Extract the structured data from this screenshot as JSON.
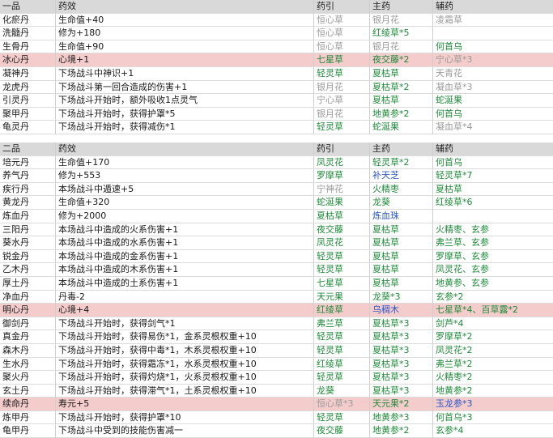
{
  "colors": {
    "header_bg": "#d9d9d9",
    "highlight_bg": "#f5cccc",
    "green": "#1f8a3a",
    "gray": "#9a9a9a",
    "blue": "#2a56c6"
  },
  "tables": [
    {
      "header": [
        "一品",
        "药效",
        "药引",
        "主药",
        "辅药"
      ],
      "rows": [
        {
          "name": "化瘀丹",
          "effect": "生命值+40",
          "yin": "恒心草",
          "yin_c": "gray",
          "main": "银月花",
          "main_c": "gray",
          "aux": "凌霜草",
          "aux_c": "gray",
          "hl": false
        },
        {
          "name": "洗髓丹",
          "effect": "修为+180",
          "yin": "恒心草",
          "yin_c": "gray",
          "main": "红绫草*5",
          "main_c": "green",
          "aux": "",
          "aux_c": "gray",
          "hl": false
        },
        {
          "name": "生骨丹",
          "effect": "生命值+90",
          "yin": "恒心草",
          "yin_c": "gray",
          "main": "银月花",
          "main_c": "gray",
          "aux": "何首乌",
          "aux_c": "green",
          "hl": false
        },
        {
          "name": "冰心丹",
          "effect": "心境+1",
          "yin": "七星草",
          "yin_c": "green",
          "main": "夜交藤*2",
          "main_c": "green",
          "aux": "宁心草*3",
          "aux_c": "gray",
          "hl": true
        },
        {
          "name": "凝神丹",
          "effect": "下场战斗中神识+1",
          "yin": "轻灵草",
          "yin_c": "green",
          "main": "夏枯草",
          "main_c": "green",
          "aux": "天青花",
          "aux_c": "gray",
          "hl": false
        },
        {
          "name": "龙虎丹",
          "effect": "下场战斗第一回合造成的伤害+1",
          "yin": "银月花",
          "yin_c": "gray",
          "main": "夏枯草*2",
          "main_c": "green",
          "aux": "凝血草*3",
          "aux_c": "gray",
          "hl": false
        },
        {
          "name": "引灵丹",
          "effect": "下场战斗开始时，额外吸收1点灵气",
          "yin": "宁心草",
          "yin_c": "gray",
          "main": "夏枯草",
          "main_c": "green",
          "aux": "蛇涎果",
          "aux_c": "green",
          "hl": false
        },
        {
          "name": "聚甲丹",
          "effect": "下场战斗开始时，获得护罩*5",
          "yin": "银月花",
          "yin_c": "gray",
          "main": "地黄参*2",
          "main_c": "green",
          "aux": "何首乌",
          "aux_c": "green",
          "hl": false
        },
        {
          "name": "龟灵丹",
          "effect": "下场战斗开始时，获得减伤*1",
          "yin": "轻灵草",
          "yin_c": "green",
          "main": "蛇涎果",
          "main_c": "green",
          "aux": "凝血草*4",
          "aux_c": "gray",
          "hl": false
        }
      ]
    },
    {
      "header": [
        "二品",
        "药效",
        "药引",
        "主药",
        "辅药"
      ],
      "rows": [
        {
          "name": "培元丹",
          "effect": "生命值+170",
          "yin": "凤灵花",
          "yin_c": "green",
          "main": "轻灵草*2",
          "main_c": "green",
          "aux": "何首乌",
          "aux_c": "green",
          "hl": false
        },
        {
          "name": "养气丹",
          "effect": "修为+553",
          "yin": "罗摩草",
          "yin_c": "green",
          "main": "补天芝",
          "main_c": "blue",
          "aux": "轻灵草*7",
          "aux_c": "green",
          "hl": false
        },
        {
          "name": "疾行丹",
          "effect": "本场战斗中遁速+5",
          "yin": "宁神花",
          "yin_c": "gray",
          "main": "火精枣",
          "main_c": "green",
          "aux": "夏枯草",
          "aux_c": "green",
          "hl": false
        },
        {
          "name": "黄龙丹",
          "effect": "生命值+320",
          "yin": "蛇涎果",
          "yin_c": "green",
          "main": "龙葵",
          "main_c": "green",
          "aux": "红绫草*6",
          "aux_c": "green",
          "hl": false
        },
        {
          "name": "炼血丹",
          "effect": "修为+2000",
          "yin": "夏枯草",
          "yin_c": "green",
          "main": "炼血珠",
          "main_c": "blue",
          "aux": "",
          "aux_c": "green",
          "hl": false
        },
        {
          "name": "三阳丹",
          "effect": "本场战斗中造成的火系伤害+1",
          "yin": "夜交藤",
          "yin_c": "green",
          "main": "夏枯草",
          "main_c": "green",
          "aux": "火精枣、玄参",
          "aux_c": "green",
          "hl": false
        },
        {
          "name": "葵水丹",
          "effect": "本场战斗中造成的水系伤害+1",
          "yin": "凤灵花",
          "yin_c": "green",
          "main": "夏枯草",
          "main_c": "green",
          "aux": "弗兰草、玄参",
          "aux_c": "green",
          "hl": false
        },
        {
          "name": "锐金丹",
          "effect": "本场战斗中造成的金系伤害+1",
          "yin": "轻灵草",
          "yin_c": "green",
          "main": "夏枯草",
          "main_c": "green",
          "aux": "罗摩草、玄参",
          "aux_c": "green",
          "hl": false
        },
        {
          "name": "乙木丹",
          "effect": "本场战斗中造成的木系伤害+1",
          "yin": "轻灵草",
          "yin_c": "green",
          "main": "夏枯草",
          "main_c": "green",
          "aux": "凤灵花、玄参",
          "aux_c": "green",
          "hl": false
        },
        {
          "name": "厚土丹",
          "effect": "本场战斗中造成的土系伤害+1",
          "yin": "七星草",
          "yin_c": "green",
          "main": "夏枯草",
          "main_c": "green",
          "aux": "地黄参、玄参",
          "aux_c": "green",
          "hl": false
        },
        {
          "name": "净血丹",
          "effect": "丹毒-2",
          "yin": "天元果",
          "yin_c": "green",
          "main": "龙葵*3",
          "main_c": "green",
          "aux": "玄参*2",
          "aux_c": "green",
          "hl": false
        },
        {
          "name": "明心丹",
          "effect": "心境+4",
          "yin": "红绫草",
          "yin_c": "green",
          "main": "乌稠木",
          "main_c": "blue",
          "aux": "七星草*4、百草露*2",
          "aux_c": "green",
          "hl": true
        },
        {
          "name": "御剑丹",
          "effect": "下场战斗开始时，获得剑气*1",
          "yin": "弗兰草",
          "yin_c": "green",
          "main": "夏枯草*3",
          "main_c": "green",
          "aux": "剑芦*4",
          "aux_c": "green",
          "hl": false
        },
        {
          "name": "真金丹",
          "effect": "下场战斗开始时，获得易伤*1，金系灵根权重+10",
          "yin": "轻灵草",
          "yin_c": "green",
          "main": "夏枯草*3",
          "main_c": "green",
          "aux": "罗摩草*2",
          "aux_c": "green",
          "hl": false
        },
        {
          "name": "森木丹",
          "effect": "下场战斗开始时，获得中毒*1，木系灵根权重+10",
          "yin": "轻灵草",
          "yin_c": "green",
          "main": "夏枯草*3",
          "main_c": "green",
          "aux": "凤灵花*2",
          "aux_c": "green",
          "hl": false
        },
        {
          "name": "生水丹",
          "effect": "下场战斗开始时，获得霜冻*1，水系灵根权重+10",
          "yin": "红绫草",
          "yin_c": "green",
          "main": "夏枯草*3",
          "main_c": "green",
          "aux": "弗兰草*2",
          "aux_c": "green",
          "hl": false
        },
        {
          "name": "聚火丹",
          "effect": "下场战斗开始时，获得灼烧*1，火系灵根权重+10",
          "yin": "轻灵草",
          "yin_c": "green",
          "main": "夏枯草*3",
          "main_c": "green",
          "aux": "火精枣*2",
          "aux_c": "green",
          "hl": false
        },
        {
          "name": "玄土丹",
          "effect": "下场战斗开始时，获得滞气*1，土系灵根权重+10",
          "yin": "龙葵",
          "yin_c": "green",
          "main": "夏枯草*3",
          "main_c": "green",
          "aux": "地黄参*2",
          "aux_c": "green",
          "hl": false
        },
        {
          "name": "续命丹",
          "effect": "寿元+5",
          "yin": "恒心草*3",
          "yin_c": "gray",
          "main": "天元果*2",
          "main_c": "green",
          "aux": "玉龙参*3",
          "aux_c": "blue",
          "hl": true
        },
        {
          "name": "炼甲丹",
          "effect": "下场战斗开始时，获得护罩*10",
          "yin": "轻灵草",
          "yin_c": "green",
          "main": "地黄参*3",
          "main_c": "green",
          "aux": "何首乌*3",
          "aux_c": "green",
          "hl": false
        },
        {
          "name": "龟甲丹",
          "effect": "下场战斗中受到的技能伤害减一",
          "yin": "夜交藤",
          "yin_c": "green",
          "main": "地黄参*2",
          "main_c": "green",
          "aux": "玄参*4",
          "aux_c": "green",
          "hl": false
        }
      ]
    }
  ]
}
